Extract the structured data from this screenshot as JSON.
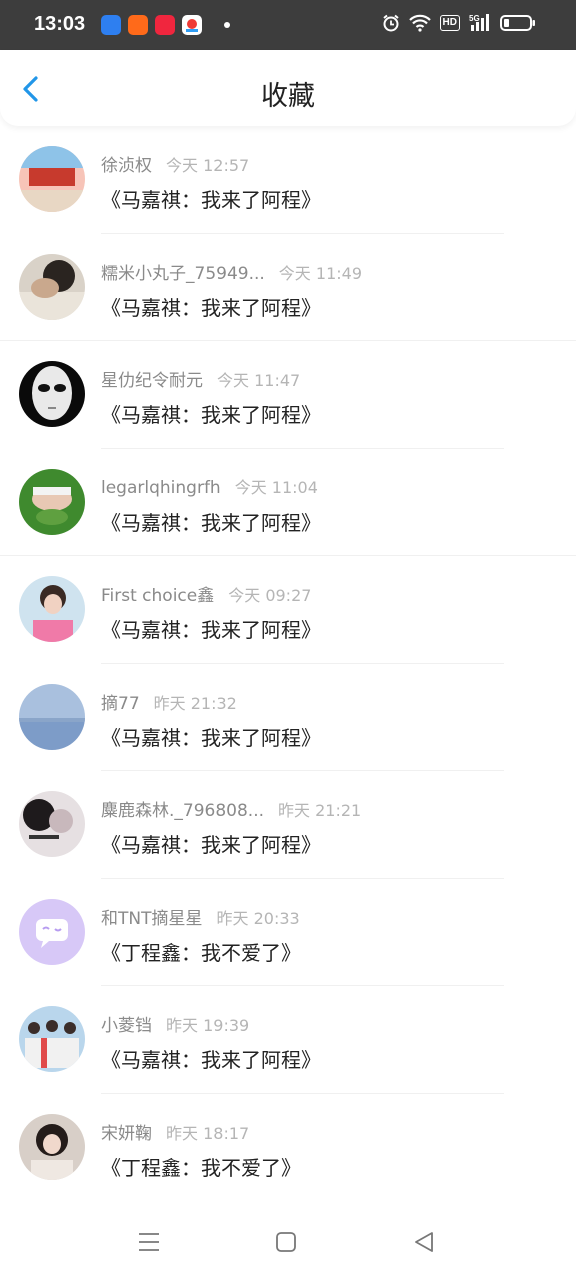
{
  "status_bar": {
    "time": "13:03",
    "app_icons": [
      "baidu-app-icon",
      "taobao-app-icon",
      "xiaohongshu-app-icon",
      "map-app-icon"
    ],
    "hd_label": "HD",
    "net_label": "5G"
  },
  "header": {
    "title": "收藏",
    "back_icon": "chevron-left-icon",
    "accent": "#2196e8"
  },
  "favorites": [
    {
      "user": "徐浈权",
      "time": "今天 12:57",
      "title": "《马嘉祺：我来了阿程》"
    },
    {
      "user": "糯米小丸子_75949...",
      "time": "今天 11:49",
      "title": "《马嘉祺：我来了阿程》"
    },
    {
      "user": "星仂纪令耐元",
      "time": "今天 11:47",
      "title": "《马嘉祺：我来了阿程》"
    },
    {
      "user": "legarlqhingrfh",
      "time": "今天 11:04",
      "title": "《马嘉祺：我来了阿程》"
    },
    {
      "user": "First choice鑫",
      "time": "今天 09:27",
      "title": "《马嘉祺：我来了阿程》"
    },
    {
      "user": "摘77",
      "time": "昨天 21:32",
      "title": "《马嘉祺：我来了阿程》"
    },
    {
      "user": "麋鹿森林._796808...",
      "time": "昨天 21:21",
      "title": "《马嘉祺：我来了阿程》"
    },
    {
      "user": "和TNT摘星星",
      "time": "昨天 20:33",
      "title": "《丁程鑫：我不爱了》"
    },
    {
      "user": "小菱铛",
      "time": "昨天 19:39",
      "title": "《马嘉祺：我来了阿程》"
    },
    {
      "user": "宋妍鞠",
      "time": "昨天 18:17",
      "title": "《丁程鑫：我不爱了》"
    }
  ],
  "nav_bar": {
    "icons": [
      "menu-icon",
      "home-square-icon",
      "back-triangle-icon"
    ]
  }
}
